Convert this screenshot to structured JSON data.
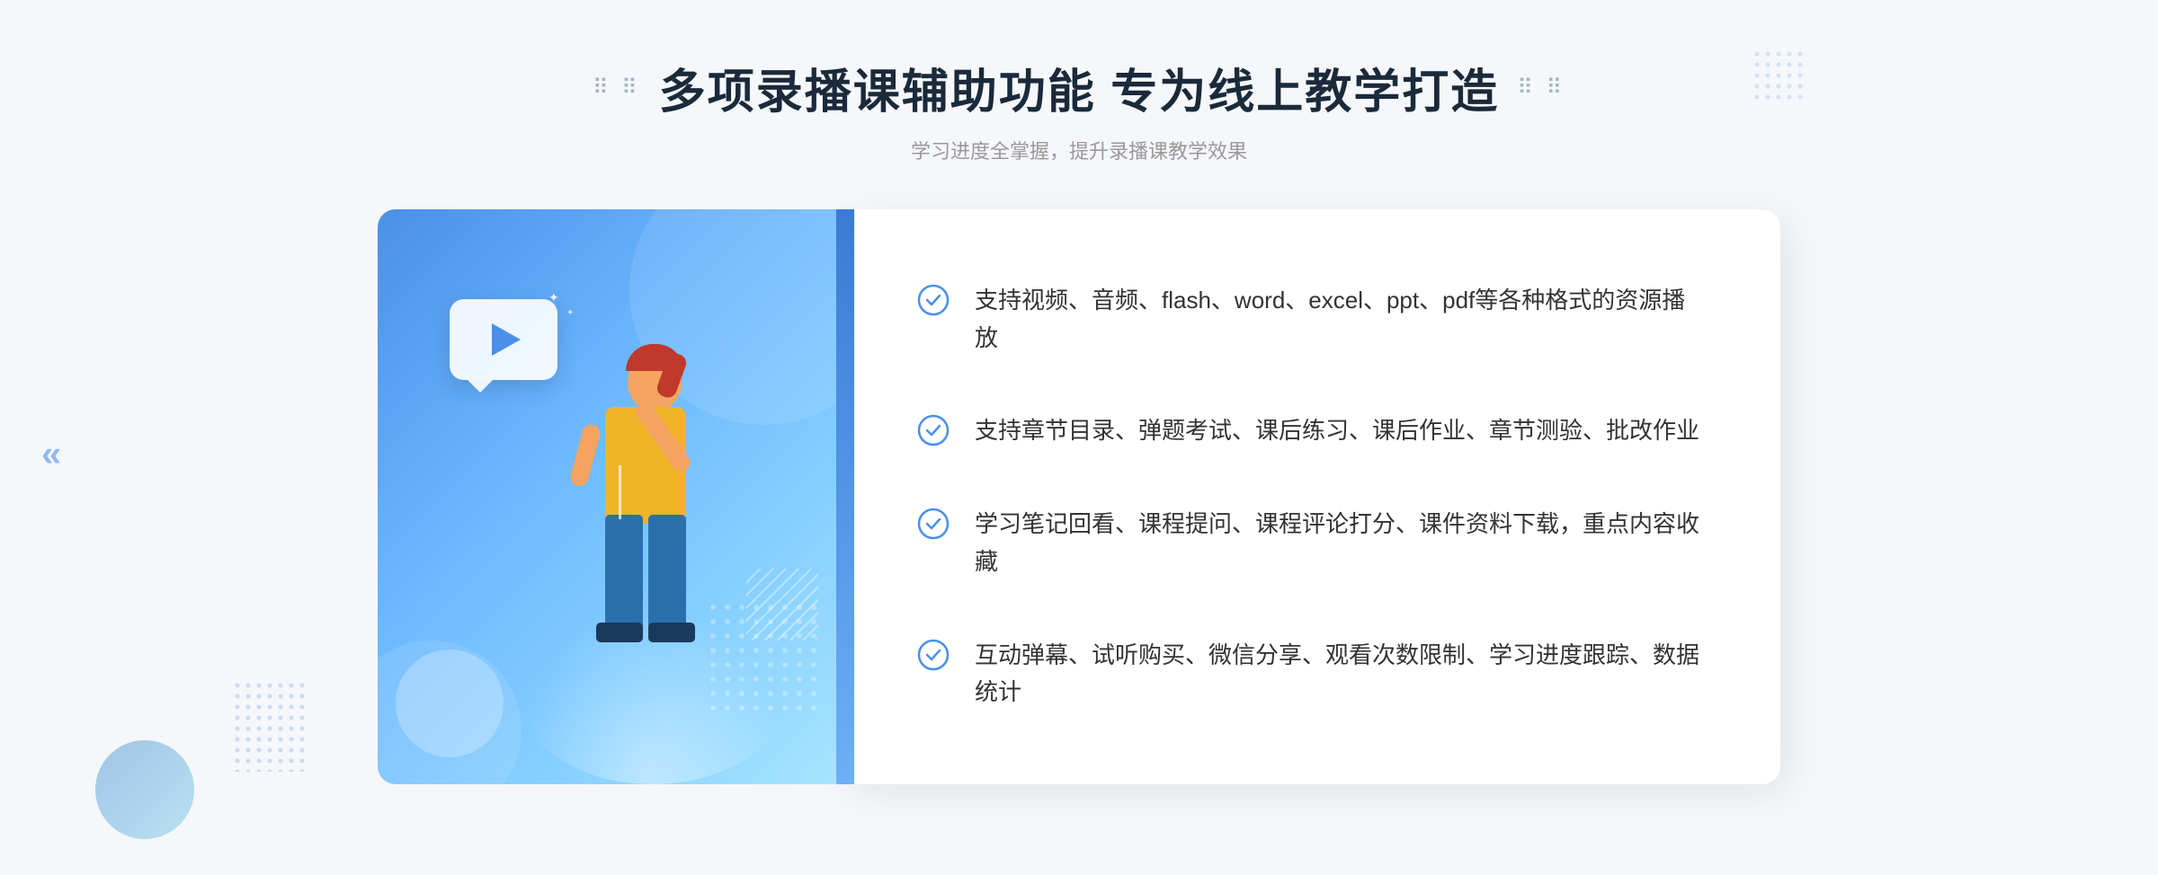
{
  "page": {
    "background_color": "#f5f7fa"
  },
  "header": {
    "decorator_left": "⠿ ⠿",
    "decorator_right": "⠿ ⠿",
    "main_title": "多项录播课辅助功能 专为线上教学打造",
    "sub_title": "学习进度全掌握，提升录播课教学效果"
  },
  "features": [
    {
      "id": 1,
      "text": "支持视频、音频、flash、word、excel、ppt、pdf等各种格式的资源播放"
    },
    {
      "id": 2,
      "text": "支持章节目录、弹题考试、课后练习、课后作业、章节测验、批改作业"
    },
    {
      "id": 3,
      "text": "学习笔记回看、课程提问、课程评论打分、课件资料下载，重点内容收藏"
    },
    {
      "id": 4,
      "text": "互动弹幕、试听购买、微信分享、观看次数限制、学习进度跟踪、数据统计"
    }
  ],
  "icons": {
    "check": "✓",
    "play": "▶",
    "arrow_left": "«",
    "sparkle": "✦"
  }
}
